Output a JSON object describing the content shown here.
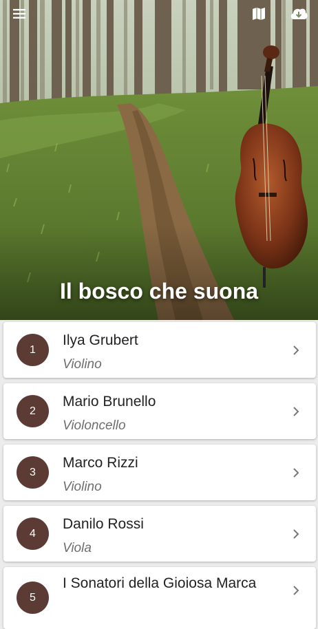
{
  "header": {
    "title": "Il bosco che suona",
    "menu_icon": "menu-icon",
    "map_icon": "map-icon",
    "download_icon": "cloud-download-icon"
  },
  "colors": {
    "badge": "#5b3b33",
    "background": "#ececec",
    "card": "#ffffff"
  },
  "artists": [
    {
      "number": "1",
      "name": "Ilya Grubert",
      "instrument": "Violino"
    },
    {
      "number": "2",
      "name": "Mario Brunello",
      "instrument": "Violoncello"
    },
    {
      "number": "3",
      "name": "Marco Rizzi",
      "instrument": "Violino"
    },
    {
      "number": "4",
      "name": "Danilo Rossi",
      "instrument": "Viola"
    },
    {
      "number": "5",
      "name": "I Sonatori della Gioiosa Marca",
      "instrument": ""
    }
  ]
}
